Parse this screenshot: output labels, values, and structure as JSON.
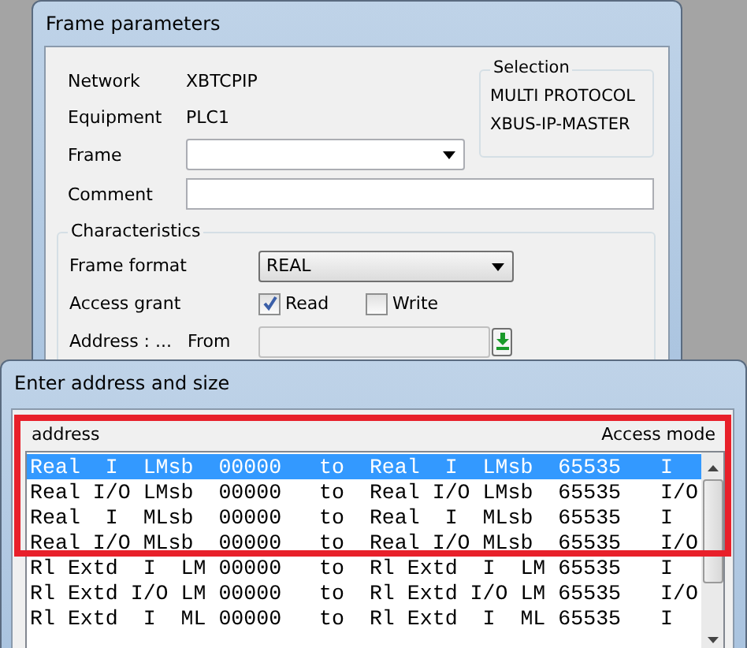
{
  "frame_window": {
    "title": "Frame parameters",
    "network": {
      "label": "Network",
      "value": "XBTCPIP"
    },
    "equipment": {
      "label": "Equipment",
      "value": "PLC1"
    },
    "frame": {
      "label": "Frame"
    },
    "comment": {
      "label": "Comment"
    },
    "selection": {
      "title": "Selection",
      "items": [
        "MULTI PROTOCOL",
        "XBUS-IP-MASTER"
      ]
    },
    "characteristics": {
      "title": "Characteristics",
      "frame_format": {
        "label": "Frame format",
        "value": "REAL"
      },
      "access_grant": {
        "label": "Access grant",
        "options": [
          {
            "label": "Read",
            "checked": true
          },
          {
            "label": "Write",
            "checked": false
          }
        ]
      },
      "address": {
        "label": "Address : ...",
        "from_label": "From"
      }
    }
  },
  "address_dialog": {
    "title": "Enter address and size",
    "columns": [
      "address",
      "Access mode"
    ],
    "rows": [
      {
        "address": "Real  I  LMsb  00000   to  Real  I  LMsb  65535",
        "access_mode": "I",
        "selected": true
      },
      {
        "address": "Real I/O LMsb  00000   to  Real I/O LMsb  65535",
        "access_mode": "I/O",
        "selected": false
      },
      {
        "address": "Real  I  MLsb  00000   to  Real  I  MLsb  65535",
        "access_mode": "I",
        "selected": false
      },
      {
        "address": "Real I/O MLsb  00000   to  Real I/O MLsb  65535",
        "access_mode": "I/O",
        "selected": false
      },
      {
        "address": "Rl Extd  I  LM 00000   to  Rl Extd  I  LM 65535",
        "access_mode": "I",
        "selected": false
      },
      {
        "address": "Rl Extd I/O LM 00000   to  Rl Extd I/O LM 65535",
        "access_mode": "I/O",
        "selected": false
      },
      {
        "address": "Rl Extd  I  ML 00000   to  Rl Extd  I  ML 65535",
        "access_mode": "I",
        "selected": false
      }
    ]
  }
}
